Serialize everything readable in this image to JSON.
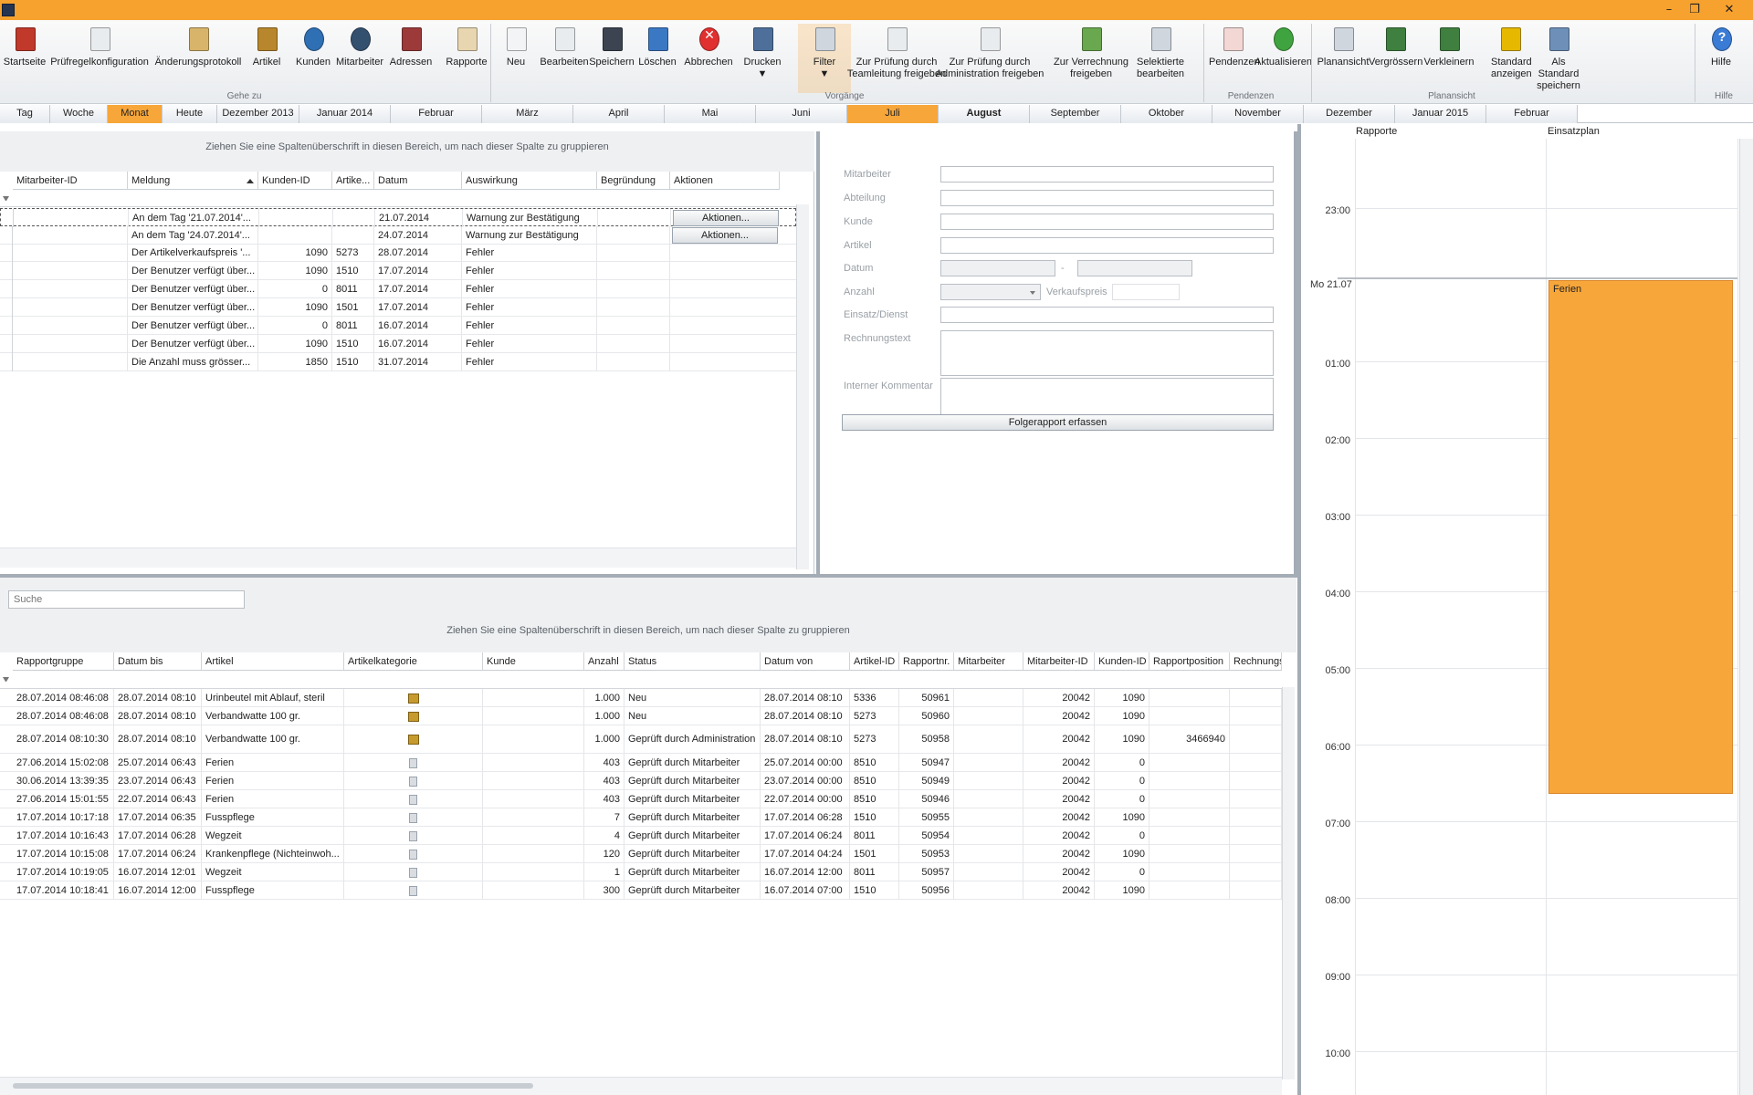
{
  "window": {
    "title": ""
  },
  "ribbon": {
    "buttons": [
      {
        "name": "startseite-button",
        "label": "Startseite",
        "icon": "house-icon"
      },
      {
        "name": "pruefregel-button",
        "label": "Prüfregelkonfiguration",
        "icon": "rules-doc-icon"
      },
      {
        "name": "aenderungsprotokoll-button",
        "label": "Änderungsprotokoll",
        "icon": "scroll-icon"
      },
      {
        "name": "artikel-button",
        "label": "Artikel",
        "icon": "box-icon"
      },
      {
        "name": "kunden-button",
        "label": "Kunden",
        "icon": "customer-icon"
      },
      {
        "name": "mitarbeiter-button",
        "label": "Mitarbeiter",
        "icon": "employee-icon"
      },
      {
        "name": "adressen-button",
        "label": "Adressen",
        "icon": "address-book-icon"
      },
      {
        "name": "rapporte-button",
        "label": "Rapporte",
        "icon": "report-icon"
      },
      {
        "name": "neu-button",
        "label": "Neu",
        "icon": "new-doc-icon"
      },
      {
        "name": "bearbeiten-button",
        "label": "Bearbeiten",
        "icon": "edit-doc-icon"
      },
      {
        "name": "speichern-button",
        "label": "Speichern",
        "icon": "floppy-icon"
      },
      {
        "name": "loeschen-button",
        "label": "Löschen",
        "icon": "delete-doc-icon"
      },
      {
        "name": "abbrechen-button",
        "label": "Abbrechen",
        "icon": "cancel-icon"
      },
      {
        "name": "drucken-button",
        "label": "Drucken\n▼",
        "icon": "printer-icon"
      },
      {
        "name": "filter-button",
        "label": "Filter\n▼",
        "icon": "filter-icon"
      },
      {
        "name": "pruefung-team-button",
        "label": "Zur Prüfung durch\nTeamleitung freigeben",
        "icon": "check-doc-icon"
      },
      {
        "name": "pruefung-admin-button",
        "label": "Zur Prüfung durch\nAdministration freigeben",
        "icon": "check-doc-icon"
      },
      {
        "name": "verrechnung-button",
        "label": "Zur Verrechnung\nfreigeben",
        "icon": "check-green-icon"
      },
      {
        "name": "selektierte-button",
        "label": "Selektierte\nbearbeiten",
        "icon": "multi-edit-icon"
      },
      {
        "name": "pendenzen-button",
        "label": "Pendenzen",
        "icon": "pending-icon"
      },
      {
        "name": "aktualisieren-button",
        "label": "Aktualisieren",
        "icon": "refresh-icon"
      },
      {
        "name": "plansicht-button",
        "label": "Planansicht",
        "icon": "plan-view-icon"
      },
      {
        "name": "vergroessern-button",
        "label": "Vergrössern",
        "icon": "zoom-in-icon"
      },
      {
        "name": "verkleinern-button",
        "label": "Verkleinern",
        "icon": "zoom-out-icon"
      },
      {
        "name": "standard-anzeigen-button",
        "label": "Standard\nanzeigen",
        "icon": "star-zoom-icon"
      },
      {
        "name": "als-standard-button",
        "label": "Als Standard\nspeichern",
        "icon": "save-standard-icon"
      },
      {
        "name": "hilfe-button",
        "label": "Hilfe",
        "icon": "help-icon"
      }
    ],
    "groups": [
      "Gehe zu",
      "Vorgänge",
      "Pendenzen",
      "Planansicht",
      "Hilfe"
    ]
  },
  "monthbar": [
    "Tag",
    "Woche",
    "Monat",
    "Heute",
    "Dezember 2013",
    "Januar 2014",
    "Februar",
    "März",
    "April",
    "Mai",
    "Juni",
    "Juli",
    "August",
    "September",
    "Oktober",
    "November",
    "Dezember",
    "Januar 2015",
    "Februar"
  ],
  "top_grid": {
    "group_hint": "Ziehen Sie eine Spaltenüberschrift in diesen Bereich, um nach dieser Spalte zu gruppieren",
    "columns": [
      "Mitarbeiter-ID",
      "Meldung",
      "Kunden-ID",
      "Artike...",
      "Datum",
      "Auswirkung",
      "Begründung",
      "Aktionen"
    ],
    "rows": [
      [
        "",
        "An dem Tag '21.07.2014'...",
        "",
        "",
        "21.07.2014",
        "Warnung zur Bestätigung",
        "",
        "Aktionen..."
      ],
      [
        "",
        "An dem Tag '24.07.2014'...",
        "",
        "",
        "24.07.2014",
        "Warnung zur Bestätigung",
        "",
        "Aktionen..."
      ],
      [
        "",
        "Der Artikelverkaufspreis '...",
        "1090",
        "5273",
        "28.07.2014",
        "Fehler",
        "",
        ""
      ],
      [
        "",
        "Der Benutzer verfügt über...",
        "1090",
        "1510",
        "17.07.2014",
        "Fehler",
        "",
        ""
      ],
      [
        "",
        "Der Benutzer verfügt über...",
        "0",
        "8011",
        "17.07.2014",
        "Fehler",
        "",
        ""
      ],
      [
        "",
        "Der Benutzer verfügt über...",
        "1090",
        "1501",
        "17.07.2014",
        "Fehler",
        "",
        ""
      ],
      [
        "",
        "Der Benutzer verfügt über...",
        "0",
        "8011",
        "16.07.2014",
        "Fehler",
        "",
        ""
      ],
      [
        "",
        "Der Benutzer verfügt über...",
        "1090",
        "1510",
        "16.07.2014",
        "Fehler",
        "",
        ""
      ],
      [
        "",
        "Die Anzahl muss grösser...",
        "1850",
        "1510",
        "31.07.2014",
        "Fehler",
        "",
        ""
      ]
    ]
  },
  "form": {
    "labels": [
      "Mitarbeiter",
      "Abteilung",
      "Kunde",
      "Artikel",
      "Datum",
      "Anzahl",
      "Verkaufspreis",
      "Einsatz/Dienst",
      "Rechnungstext",
      "Interner Kommentar"
    ],
    "date_separator": "-",
    "followup_button": "Folgerapport erfassen"
  },
  "bottom_grid": {
    "search_placeholder": "Suche",
    "group_hint": "Ziehen Sie eine Spaltenüberschrift in diesen Bereich, um nach dieser Spalte zu gruppieren",
    "columns": [
      "Rapportgruppe",
      "Datum bis",
      "Artikel",
      "Artikelkategorie",
      "Kunde",
      "Anzahl",
      "Status",
      "Datum von",
      "Artikel-ID",
      "Rapportnr.",
      "Mitarbeiter",
      "Mitarbeiter-ID",
      "Kunden-ID",
      "Rapportposition",
      "Rechnungs"
    ],
    "rows": [
      [
        "28.07.2014 08:46:08",
        "28.07.2014 08:10",
        "Urinbeutel mit Ablauf, steril",
        "package-icon",
        "",
        "1.000",
        "Neu",
        "28.07.2014 08:10",
        "5336",
        "50961",
        "",
        "20042",
        "1090",
        "",
        ""
      ],
      [
        "28.07.2014 08:46:08",
        "28.07.2014 08:10",
        "Verbandwatte 100 gr.",
        "package-icon",
        "",
        "1.000",
        "Neu",
        "28.07.2014 08:10",
        "5273",
        "50960",
        "",
        "20042",
        "1090",
        "",
        ""
      ],
      [
        "28.07.2014 08:10:30",
        "28.07.2014 08:10",
        "Verbandwatte 100 gr.",
        "package-icon",
        "",
        "1.000",
        "Geprüft durch Administration",
        "28.07.2014 08:10",
        "5273",
        "50958",
        "",
        "20042",
        "1090",
        "3466940",
        ""
      ],
      [
        "27.06.2014 15:02:08",
        "25.07.2014 06:43",
        "Ferien",
        "document-icon",
        "",
        "403",
        "Geprüft durch Mitarbeiter",
        "25.07.2014 00:00",
        "8510",
        "50947",
        "",
        "20042",
        "0",
        "",
        ""
      ],
      [
        "30.06.2014 13:39:35",
        "23.07.2014 06:43",
        "Ferien",
        "document-icon",
        "",
        "403",
        "Geprüft durch Mitarbeiter",
        "23.07.2014 00:00",
        "8510",
        "50949",
        "",
        "20042",
        "0",
        "",
        ""
      ],
      [
        "27.06.2014 15:01:55",
        "22.07.2014 06:43",
        "Ferien",
        "document-icon",
        "",
        "403",
        "Geprüft durch Mitarbeiter",
        "22.07.2014 00:00",
        "8510",
        "50946",
        "",
        "20042",
        "0",
        "",
        ""
      ],
      [
        "17.07.2014 10:17:18",
        "17.07.2014 06:35",
        "Fusspflege",
        "document-icon",
        "",
        "7",
        "Geprüft durch Mitarbeiter",
        "17.07.2014 06:28",
        "1510",
        "50955",
        "",
        "20042",
        "1090",
        "",
        ""
      ],
      [
        "17.07.2014 10:16:43",
        "17.07.2014 06:28",
        "Wegzeit",
        "document-icon",
        "",
        "4",
        "Geprüft durch Mitarbeiter",
        "17.07.2014 06:24",
        "8011",
        "50954",
        "",
        "20042",
        "0",
        "",
        ""
      ],
      [
        "17.07.2014 10:15:08",
        "17.07.2014 06:24",
        "Krankenpflege (Nichteinwoh...",
        "document-icon",
        "",
        "120",
        "Geprüft durch Mitarbeiter",
        "17.07.2014 04:24",
        "1501",
        "50953",
        "",
        "20042",
        "1090",
        "",
        ""
      ],
      [
        "17.07.2014 10:19:05",
        "16.07.2014 12:01",
        "Wegzeit",
        "document-icon",
        "",
        "1",
        "Geprüft durch Mitarbeiter",
        "16.07.2014 12:00",
        "8011",
        "50957",
        "",
        "20042",
        "0",
        "",
        ""
      ],
      [
        "17.07.2014 10:18:41",
        "16.07.2014 12:00",
        "Fusspflege",
        "document-icon",
        "",
        "300",
        "Geprüft durch Mitarbeiter",
        "16.07.2014 07:00",
        "1510",
        "50956",
        "",
        "20042",
        "1090",
        "",
        ""
      ]
    ]
  },
  "calendar": {
    "col_rapporte": "Rapporte",
    "col_einsatzplan": "Einsatzplan",
    "day_label": "Mo 21.07",
    "times": [
      "23:00",
      "01:00",
      "02:00",
      "03:00",
      "04:00",
      "05:00",
      "06:00",
      "07:00",
      "08:00",
      "09:00",
      "10:00"
    ],
    "event": {
      "label": "Ferien",
      "color": "#f7a63a"
    }
  },
  "colors": {
    "accent": "#f7a12e",
    "selected": "#f7a63a"
  }
}
